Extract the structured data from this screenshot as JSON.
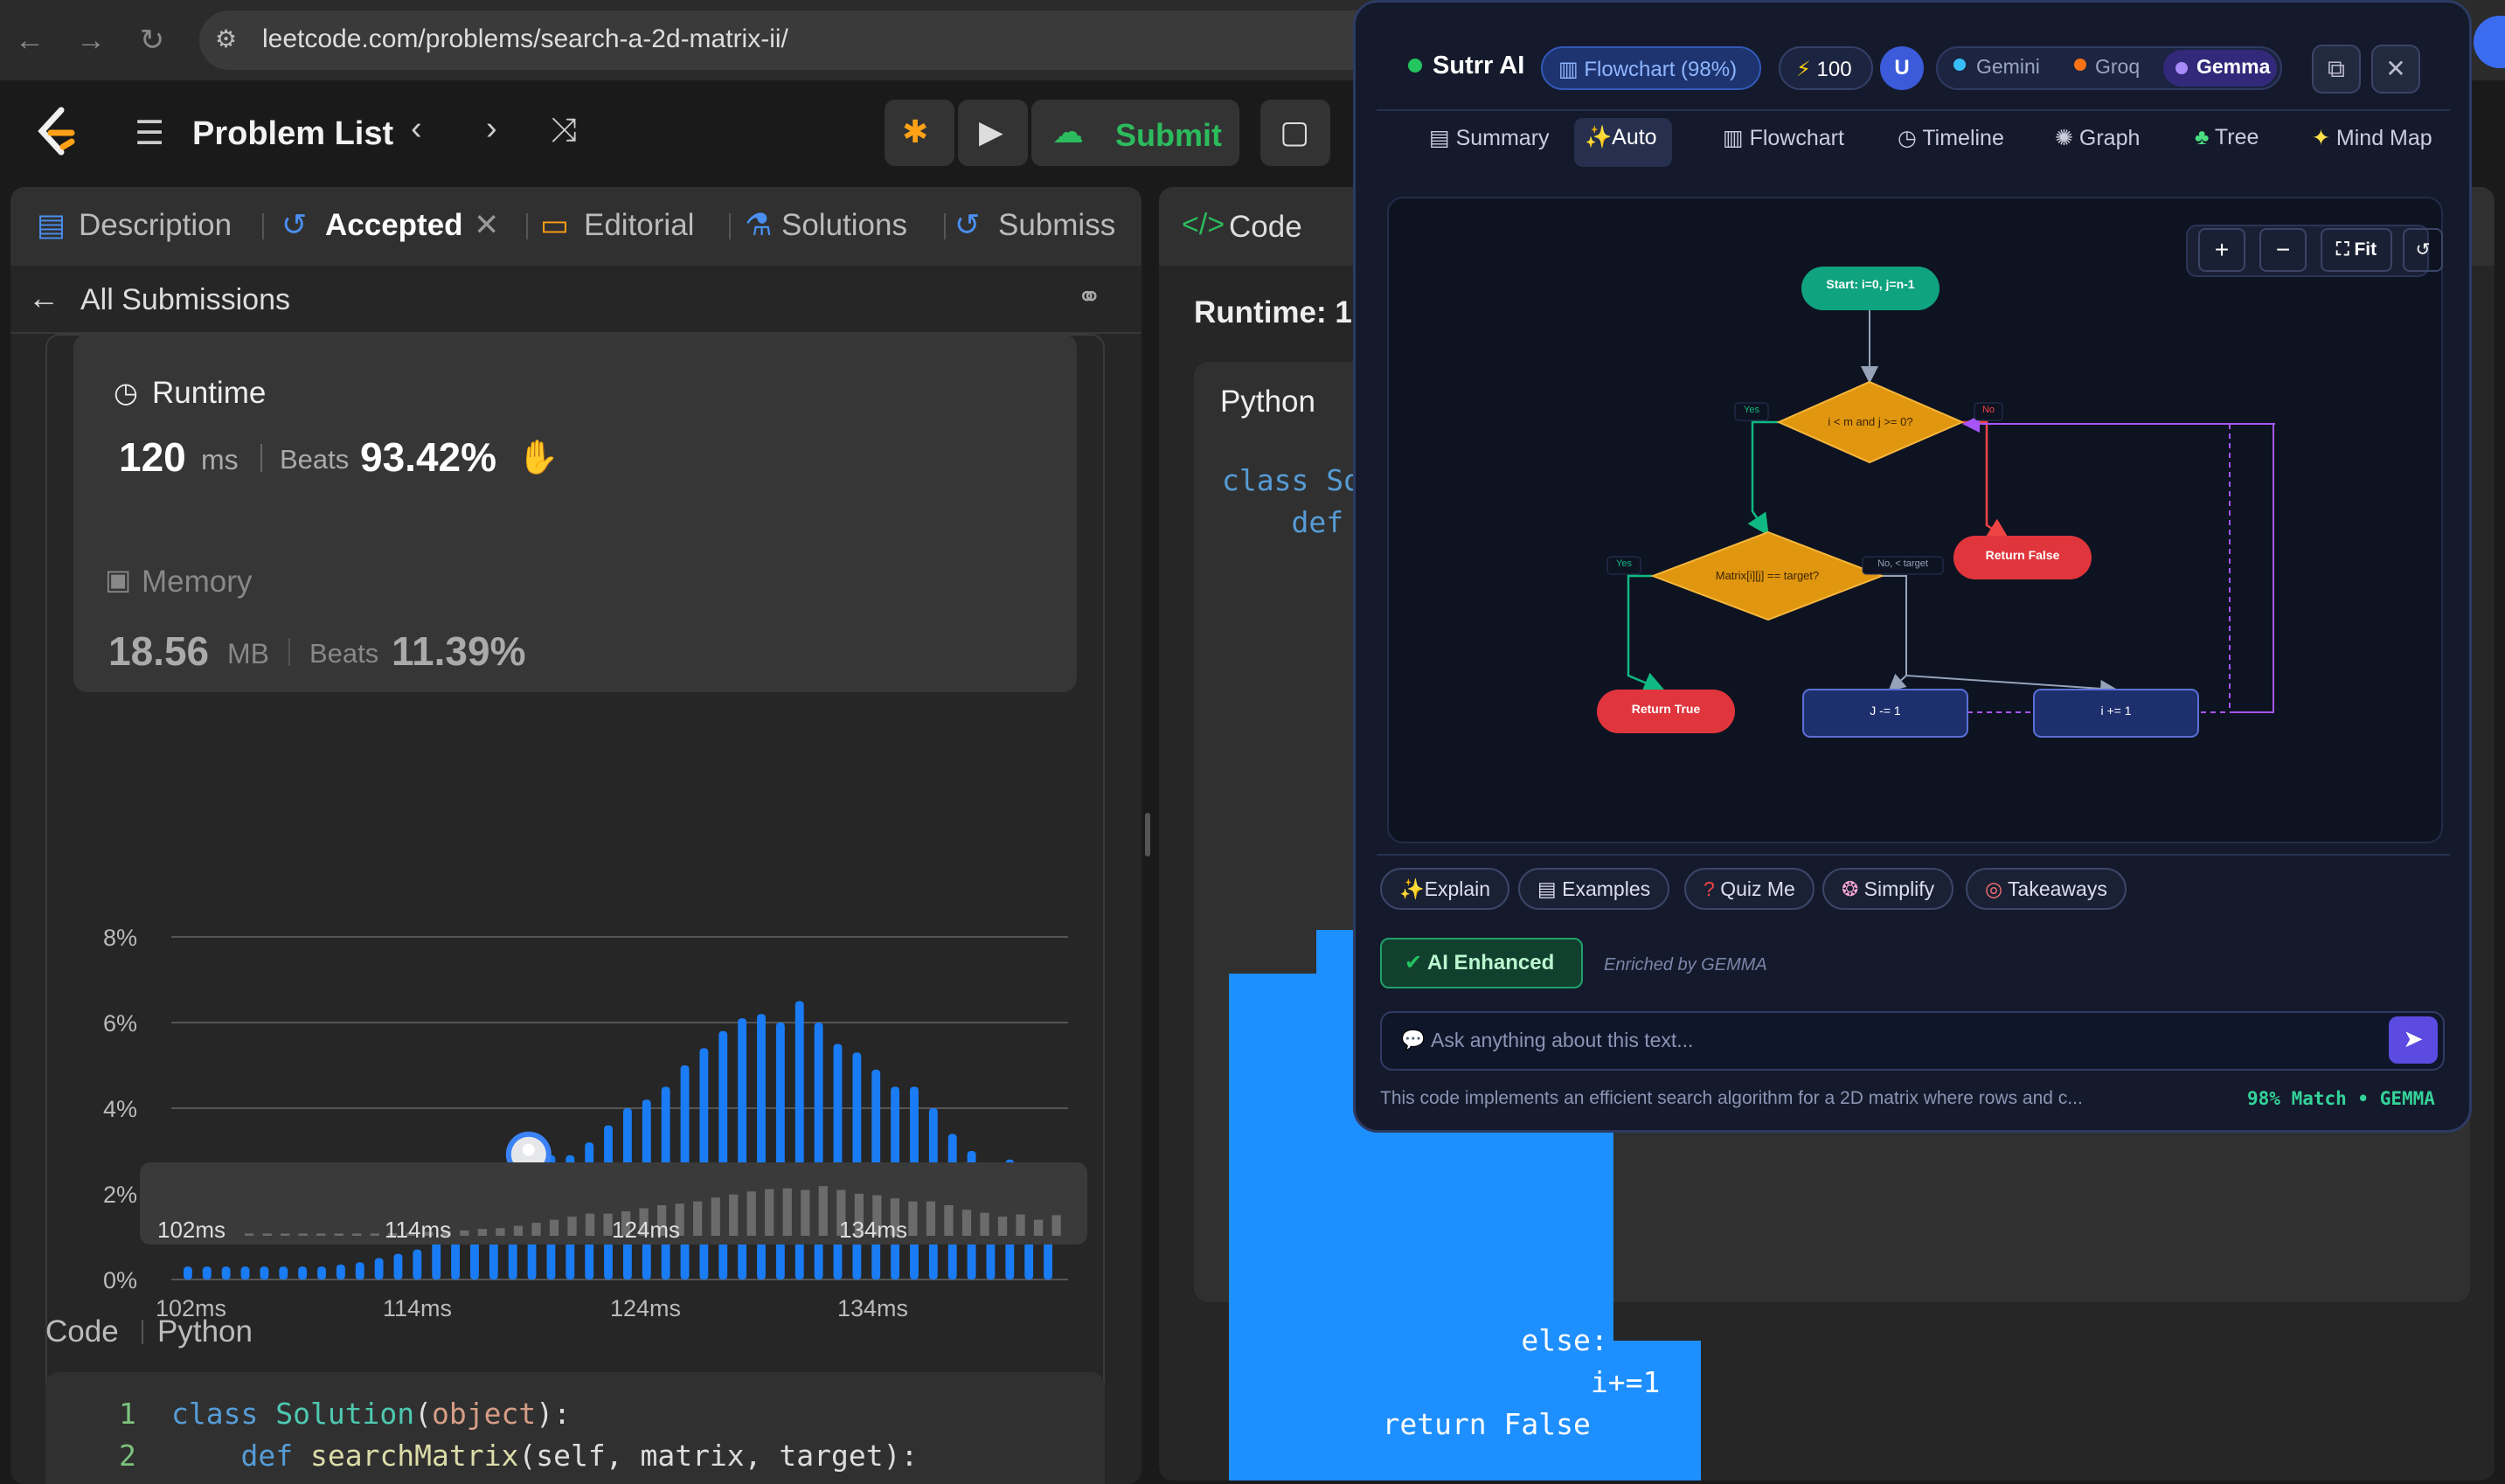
{
  "browser": {
    "url": "leetcode.com/problems/search-a-2d-matrix-ii/"
  },
  "header": {
    "problem_list": "Problem List",
    "submit": "Submit"
  },
  "left_tabs": [
    {
      "label": "Description"
    },
    {
      "label": "Accepted"
    },
    {
      "label": "Editorial"
    },
    {
      "label": "Solutions"
    },
    {
      "label": "Submiss"
    }
  ],
  "submissions": {
    "back_label": "All Submissions",
    "runtime_title": "Runtime",
    "runtime_value": "120",
    "runtime_unit": "ms",
    "beats_label": "Beats",
    "runtime_beats": "93.42%",
    "memory_title": "Memory",
    "memory_value": "18.56",
    "memory_unit": "MB",
    "memory_beats": "11.39%"
  },
  "chart_data": {
    "type": "bar",
    "yticks": [
      "8%",
      "6%",
      "4%",
      "2%",
      "0%"
    ],
    "xticks": [
      "102ms",
      "114ms",
      "124ms",
      "134ms"
    ],
    "ylim": [
      0,
      8
    ],
    "values": [
      0.3,
      0.3,
      0.3,
      0.3,
      0.3,
      0.3,
      0.3,
      0.3,
      0.35,
      0.4,
      0.5,
      0.6,
      0.7,
      0.9,
      1.0,
      1.3,
      1.7,
      2.1,
      2.5,
      2.9,
      2.9,
      3.2,
      3.6,
      4.0,
      4.2,
      4.5,
      5.0,
      5.4,
      5.8,
      6.1,
      6.2,
      6.0,
      6.5,
      6.0,
      5.5,
      5.3,
      4.9,
      4.5,
      4.5,
      4.0,
      3.4,
      3.0,
      2.5,
      2.8,
      2.1,
      2.7
    ],
    "highlight_index": 16
  },
  "code_section": {
    "label_code": "Code",
    "label_lang": "Python",
    "lines": [
      {
        "num": "1",
        "text": "class Solution(object):"
      },
      {
        "num": "2",
        "text": "    def searchMatrix(self, matrix, target):"
      }
    ]
  },
  "right": {
    "tab_code": "Code",
    "runtime_label": "Runtime: 1(",
    "lang": "Python",
    "code_visible": [
      "class So",
      "    def s",
      "            else:",
      "                i+=1",
      "    return False"
    ]
  },
  "sutrr": {
    "title": "Sutrr AI",
    "mode_chip": "Flowchart (98%)",
    "credits": "100",
    "avatar": "U",
    "models": [
      "Gemini",
      "Groq",
      "Gemma"
    ],
    "active_model": "Gemma",
    "view_tabs": [
      "Summary",
      "Auto",
      "Flowchart",
      "Timeline",
      "Graph",
      "Tree",
      "Mind Map"
    ],
    "fit_label": "Fit",
    "flow": {
      "start": "Start: i=0, j=n-1",
      "cond1": "i < m and j >= 0?",
      "cond2": "Matrix[i][j] == target?",
      "return_true": "Return True",
      "return_false": "Return False",
      "dec_j": "J -= 1",
      "inc_i": "i += 1",
      "yes1": "Yes",
      "no1": "No",
      "yes2": "Yes",
      "no2": "No, < target"
    },
    "quick_actions": [
      "Explain",
      "Examples",
      "Quiz Me",
      "Simplify",
      "Takeaways"
    ],
    "enhanced_label": "AI Enhanced",
    "enriched_by": "Enriched by GEMMA",
    "ask_placeholder": "Ask anything about this text...",
    "summary_text": "This code implements an efficient search algorithm for a 2D matrix where rows and c...",
    "match_text": "98% Match • GEMMA"
  },
  "colors": {
    "bar": "#1a7cf5",
    "accent_green": "#2cbb5d",
    "flow_start": "#10a37f",
    "flow_decision": "#e0960f",
    "flow_return": "#e0353c",
    "flow_process": "#1e2f6e"
  }
}
